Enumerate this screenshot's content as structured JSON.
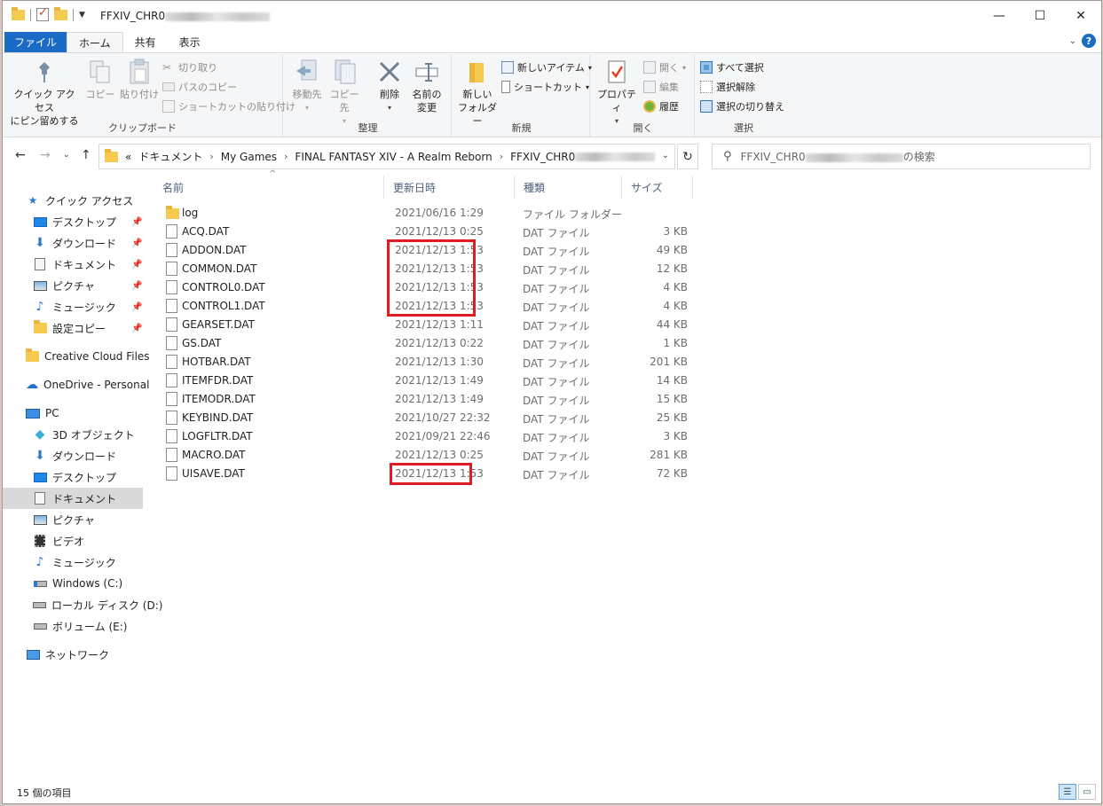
{
  "window": {
    "title_visible": "FFXIV_CHR0",
    "controls": {
      "minimize": "—",
      "maximize": "☐",
      "close": "✕"
    }
  },
  "ribbon_tabs": [
    "ファイル",
    "ホーム",
    "共有",
    "表示"
  ],
  "ribbon": {
    "clipboard": {
      "pin_label_1": "クイック アクセス",
      "pin_label_2": "にピン留めする",
      "copy": "コピー",
      "paste": "貼り付け",
      "cut": "切り取り",
      "copy_path": "パスのコピー",
      "paste_shortcut": "ショートカットの貼り付け",
      "group": "クリップボード"
    },
    "organize": {
      "move_to": "移動先",
      "copy_to": "コピー先",
      "delete": "削除",
      "rename_1": "名前の",
      "rename_2": "変更",
      "group": "整理"
    },
    "new": {
      "new_folder_1": "新しい",
      "new_folder_2": "フォルダー",
      "new_item": "新しいアイテム",
      "shortcut": "ショートカット",
      "group": "新規"
    },
    "open": {
      "properties": "プロパティ",
      "open": "開く",
      "edit": "編集",
      "history": "履歴",
      "group": "開く"
    },
    "select": {
      "select_all": "すべて選択",
      "select_none": "選択解除",
      "invert": "選択の切り替え",
      "group": "選択"
    }
  },
  "address": {
    "overflow": "«",
    "crumbs": [
      "ドキュメント",
      "My Games",
      "FINAL FANTASY XIV - A Realm Reborn",
      "FFXIV_CHR0"
    ],
    "search_prefix": "FFXIV_CHR0",
    "search_suffix": "の検索"
  },
  "nav": {
    "quick_access": "クイック アクセス",
    "quick_items": [
      "デスクトップ",
      "ダウンロード",
      "ドキュメント",
      "ピクチャ",
      "ミュージック",
      "設定コピー"
    ],
    "creative_cloud": "Creative Cloud Files",
    "onedrive": "OneDrive - Personal",
    "pc": "PC",
    "pc_items": [
      "3D オブジェクト",
      "ダウンロード",
      "デスクトップ",
      "ドキュメント",
      "ピクチャ",
      "ビデオ",
      "ミュージック",
      "Windows (C:)",
      "ローカル ディスク (D:)",
      "ボリューム (E:)"
    ],
    "network": "ネットワーク"
  },
  "columns": {
    "name": "名前",
    "date": "更新日時",
    "type": "種類",
    "size": "サイズ"
  },
  "files": [
    {
      "name": "log",
      "date": "2021/06/16 1:29",
      "type": "ファイル フォルダー",
      "size": "",
      "folder": true
    },
    {
      "name": "ACQ.DAT",
      "date": "2021/12/13 0:25",
      "type": "DAT ファイル",
      "size": "3 KB"
    },
    {
      "name": "ADDON.DAT",
      "date": "2021/12/13 1:53",
      "type": "DAT ファイル",
      "size": "49 KB"
    },
    {
      "name": "COMMON.DAT",
      "date": "2021/12/13 1:53",
      "type": "DAT ファイル",
      "size": "12 KB"
    },
    {
      "name": "CONTROL0.DAT",
      "date": "2021/12/13 1:53",
      "type": "DAT ファイル",
      "size": "4 KB"
    },
    {
      "name": "CONTROL1.DAT",
      "date": "2021/12/13 1:53",
      "type": "DAT ファイル",
      "size": "4 KB"
    },
    {
      "name": "GEARSET.DAT",
      "date": "2021/12/13 1:11",
      "type": "DAT ファイル",
      "size": "44 KB"
    },
    {
      "name": "GS.DAT",
      "date": "2021/12/13 0:22",
      "type": "DAT ファイル",
      "size": "1 KB"
    },
    {
      "name": "HOTBAR.DAT",
      "date": "2021/12/13 1:30",
      "type": "DAT ファイル",
      "size": "201 KB"
    },
    {
      "name": "ITEMFDR.DAT",
      "date": "2021/12/13 1:49",
      "type": "DAT ファイル",
      "size": "14 KB"
    },
    {
      "name": "ITEMODR.DAT",
      "date": "2021/12/13 1:49",
      "type": "DAT ファイル",
      "size": "15 KB"
    },
    {
      "name": "KEYBIND.DAT",
      "date": "2021/10/27 22:32",
      "type": "DAT ファイル",
      "size": "25 KB"
    },
    {
      "name": "LOGFLTR.DAT",
      "date": "2021/09/21 22:46",
      "type": "DAT ファイル",
      "size": "3 KB"
    },
    {
      "name": "MACRO.DAT",
      "date": "2021/12/13 0:25",
      "type": "DAT ファイル",
      "size": "281 KB"
    },
    {
      "name": "UISAVE.DAT",
      "date": "2021/12/13 1:53",
      "type": "DAT ファイル",
      "size": "72 KB"
    }
  ],
  "status": {
    "count": "15 個の項目"
  },
  "colors": {
    "accent": "#1a6bc6",
    "highlight_box": "#e01b24",
    "selected_nav": "#d9d9d9"
  }
}
